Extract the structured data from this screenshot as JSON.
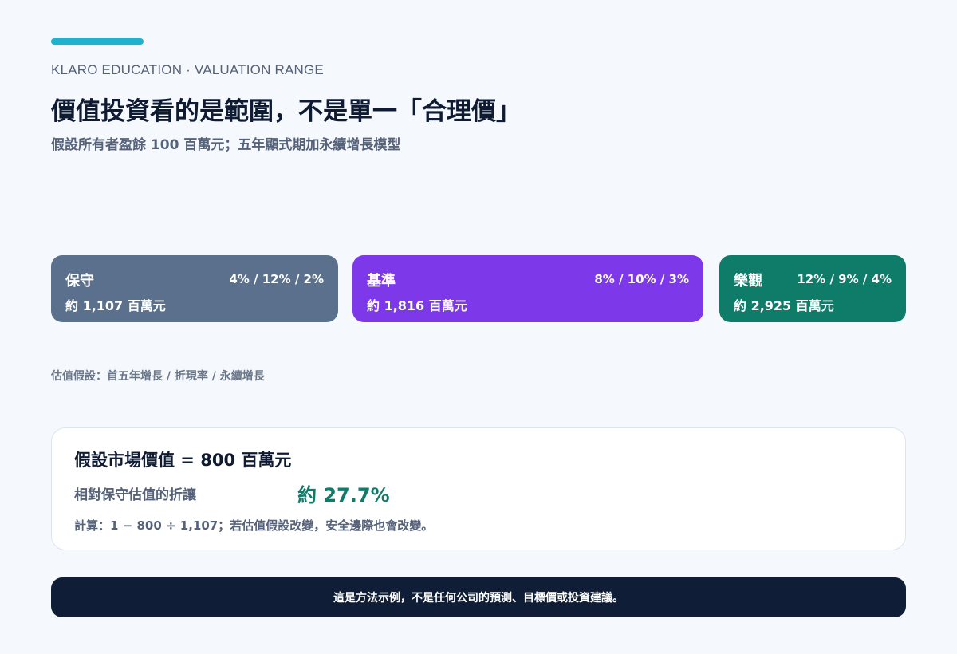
{
  "header": {
    "eyebrow": "KLARO EDUCATION · VALUATION RANGE",
    "title": "價值投資看的是範圍，不是單一「合理價」",
    "subtitle": "假設所有者盈餘 100 百萬元；五年顯式期加永續增長模型",
    "accent_color": "#1db3cf"
  },
  "scenarios": [
    {
      "name": "保守",
      "params": "4% / 12% / 2%",
      "value": "約 1,107 百萬元",
      "color": "#5a708c"
    },
    {
      "name": "基準",
      "params": "8% / 10% / 3%",
      "value": "約 1,816 百萬元",
      "color": "#7d38ea"
    },
    {
      "name": "樂觀",
      "params": "12% / 9% / 4%",
      "value": "約 2,925 百萬元",
      "color": "#0e7c68"
    }
  ],
  "assumption_note": "估值假設：首五年增長 / 折現率 / 永續增長",
  "market": {
    "headline": "假設市場價值 = 800 百萬元",
    "discount_label": "相對保守估值的折讓",
    "discount_value": "約 27.7%",
    "calc": "計算：1 − 800 ÷ 1,107；若估值假設改變，安全邊際也會改變。"
  },
  "disclaimer": "這是方法示例，不是任何公司的預測、目標價或投資建議。"
}
